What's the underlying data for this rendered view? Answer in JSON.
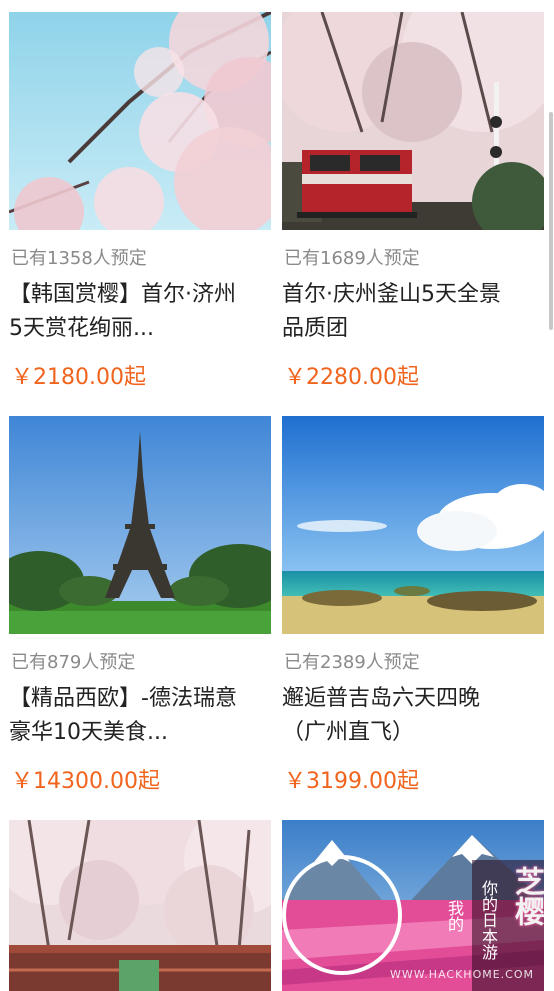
{
  "items": [
    {
      "booked": "已有1358人预定",
      "title_line1": "【韩国赏樱】首尔·济州",
      "title_line2": "5天赏花绚丽...",
      "price": "￥2180.00起",
      "image_icon": "cherry-blossom-sky-image"
    },
    {
      "booked": "已有1689人预定",
      "title_line1": "首尔·庆州釜山5天全景",
      "title_line2": "品质团",
      "price": "￥2280.00起",
      "image_icon": "train-cherry-blossom-image"
    },
    {
      "booked": "已有879人预定",
      "title_line1": "【精品西欧】-德法瑞意",
      "title_line2": "豪华10天美食...",
      "price": "￥14300.00起",
      "image_icon": "eiffel-tower-image"
    },
    {
      "booked": "已有2389人预定",
      "title_line1": "邂逅普吉岛六天四晚",
      "title_line2": "（广州直飞）",
      "price": "￥3199.00起",
      "image_icon": "beach-sea-image"
    },
    {
      "image_icon": "cherry-blossom-bridge-image"
    },
    {
      "image_icon": "mount-fuji-shibazakura-image",
      "overlay_text": "你的日本游",
      "overlay_text2": "我的",
      "overlay_text3": "芝樱"
    }
  ],
  "watermark": "WWW.HACKHOME.COM",
  "colors": {
    "price": "#f0641e",
    "booked": "#8a8a8a",
    "title": "#222222"
  }
}
